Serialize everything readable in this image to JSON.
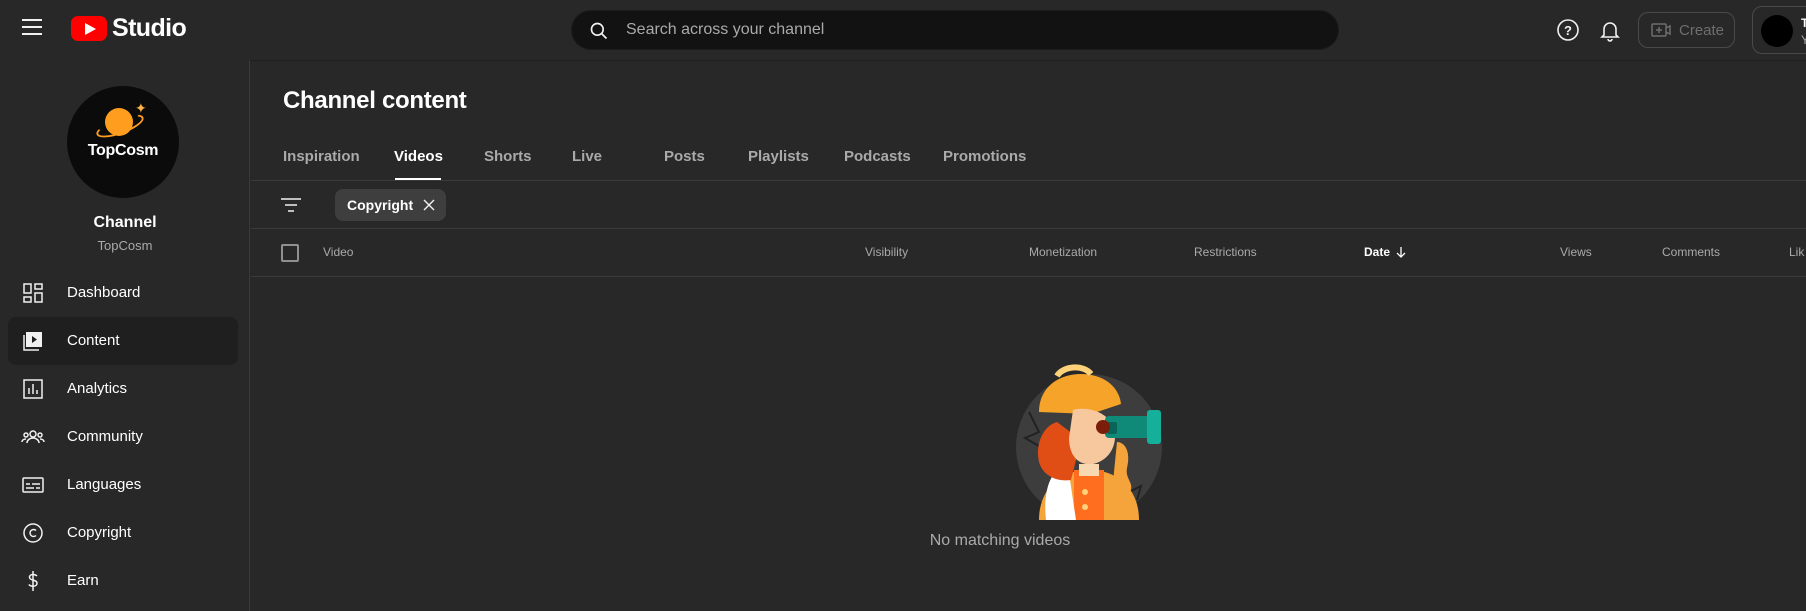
{
  "header": {
    "logo_text": "Studio",
    "search": {
      "placeholder": "Search across your channel"
    },
    "create_label": "Create",
    "account": {
      "name": "T",
      "sub": "Y"
    }
  },
  "sidebar": {
    "avatar_text": "TopCosm",
    "channel_title": "Channel",
    "channel_handle": "TopCosm",
    "items": [
      {
        "label": "Dashboard",
        "icon": "dashboard-icon"
      },
      {
        "label": "Content",
        "icon": "content-icon",
        "active": true
      },
      {
        "label": "Analytics",
        "icon": "analytics-icon"
      },
      {
        "label": "Community",
        "icon": "community-icon"
      },
      {
        "label": "Languages",
        "icon": "languages-icon"
      },
      {
        "label": "Copyright",
        "icon": "copyright-icon"
      },
      {
        "label": "Earn",
        "icon": "earn-icon"
      }
    ]
  },
  "main": {
    "title": "Channel content",
    "tabs": [
      {
        "label": "Inspiration"
      },
      {
        "label": "Videos",
        "active": true
      },
      {
        "label": "Shorts"
      },
      {
        "label": "Live"
      },
      {
        "label": "Posts"
      },
      {
        "label": "Playlists"
      },
      {
        "label": "Podcasts"
      },
      {
        "label": "Promotions"
      }
    ],
    "filter_chip": "Copyright",
    "columns": {
      "video": "Video",
      "visibility": "Visibility",
      "monetization": "Monetization",
      "restrictions": "Restrictions",
      "date": "Date",
      "views": "Views",
      "comments": "Comments",
      "likes": "Lik"
    },
    "empty_message": "No matching videos"
  },
  "colors": {
    "brand_red": "#ff0000",
    "accent_orange": "#ff9d1f",
    "background": "#282828"
  }
}
